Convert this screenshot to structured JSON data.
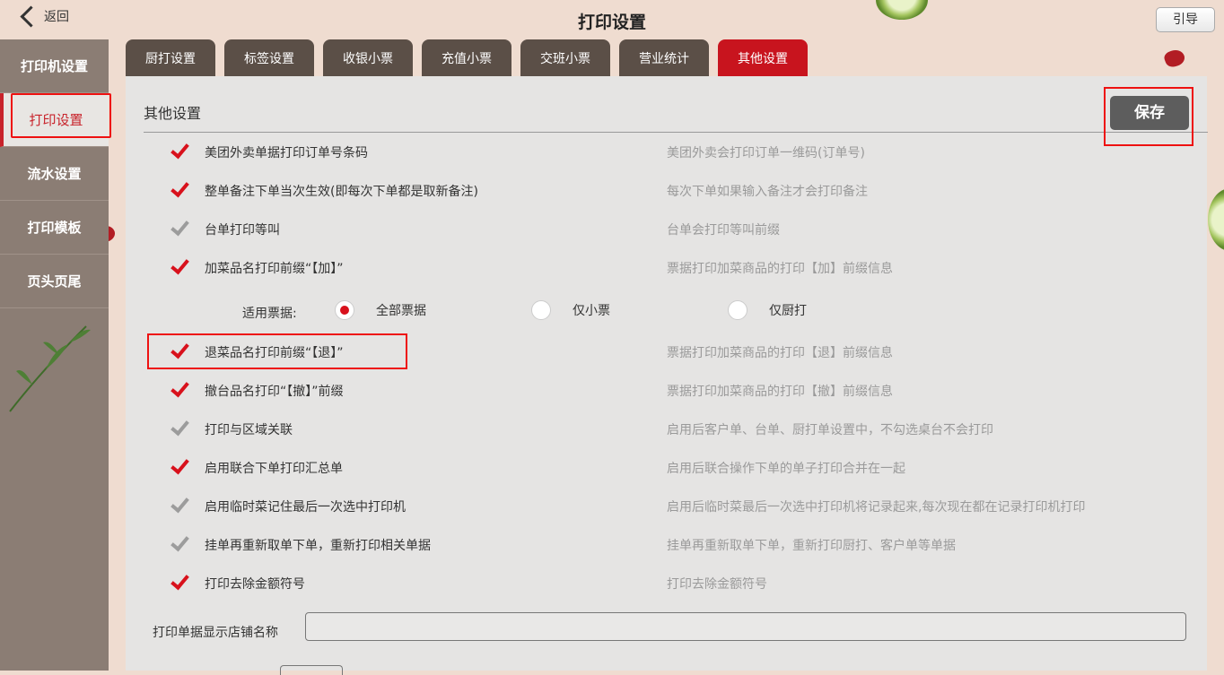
{
  "header": {
    "back_label": "返回",
    "title": "打印设置",
    "guide_label": "引导"
  },
  "sidebar": {
    "items": [
      {
        "label": "打印机设置",
        "active": false
      },
      {
        "label": "打印设置",
        "active": true
      },
      {
        "label": "流水设置",
        "active": false
      },
      {
        "label": "打印模板",
        "active": false
      },
      {
        "label": "页头页尾",
        "active": false
      }
    ]
  },
  "tabs": [
    {
      "label": "厨打设置",
      "active": false
    },
    {
      "label": "标签设置",
      "active": false
    },
    {
      "label": "收银小票",
      "active": false
    },
    {
      "label": "充值小票",
      "active": false
    },
    {
      "label": "交班小票",
      "active": false
    },
    {
      "label": "营业统计",
      "active": false
    },
    {
      "label": "其他设置",
      "active": true
    }
  ],
  "panel": {
    "title": "其他设置",
    "save_label": "保存",
    "options": [
      {
        "name": "美团外卖单据打印订单号条码",
        "desc": "美团外卖会打印订单一维码(订单号)",
        "checked": true
      },
      {
        "name": "整单备注下单当次生效(即每次下单都是取新备注)",
        "desc": "每次下单如果输入备注才会打印备注",
        "checked": true
      },
      {
        "name": "台单打印等叫",
        "desc": "台单会打印等叫前缀",
        "checked": false
      },
      {
        "name": "加菜品名打印前缀“【加】”",
        "desc": "票据打印加菜商品的打印【加】前缀信息",
        "checked": true
      },
      {
        "name": "退菜品名打印前缀“【退】”",
        "desc": "票据打印加菜商品的打印【退】前缀信息",
        "checked": true
      },
      {
        "name": "撤台品名打印“【撤】”前缀",
        "desc": "票据打印加菜商品的打印【撤】前缀信息",
        "checked": true
      },
      {
        "name": "打印与区域关联",
        "desc": "启用后客户单、台单、厨打单设置中，不勾选桌台不会打印",
        "checked": false
      },
      {
        "name": "启用联合下单打印汇总单",
        "desc": "启用后联合操作下单的单子打印合并在一起",
        "checked": true
      },
      {
        "name": "启用临时菜记住最后一次选中打印机",
        "desc": "启用后临时菜最后一次选中打印机将记录起来,每次现在都在记录打印机打印",
        "checked": false
      },
      {
        "name": "挂单再重新取单下单，重新打印相关单据",
        "desc": "挂单再重新取单下单，重新打印厨打、客户单等单据",
        "checked": false
      },
      {
        "name": "打印去除金额符号",
        "desc": "打印去除金额符号",
        "checked": true
      }
    ],
    "ticket_scope": {
      "label": "适用票据:",
      "choices": [
        {
          "label": "全部票据",
          "selected": true
        },
        {
          "label": "仅小票",
          "selected": false
        },
        {
          "label": "仅厨打",
          "selected": false
        }
      ]
    },
    "store_name": {
      "label": "打印单据显示店铺名称",
      "value": ""
    }
  },
  "colors": {
    "accent": "#c8141e",
    "tab_dark": "#5b4f47",
    "sidebar_bg": "#8b7d74",
    "panel_bg": "#e5e4e3"
  }
}
